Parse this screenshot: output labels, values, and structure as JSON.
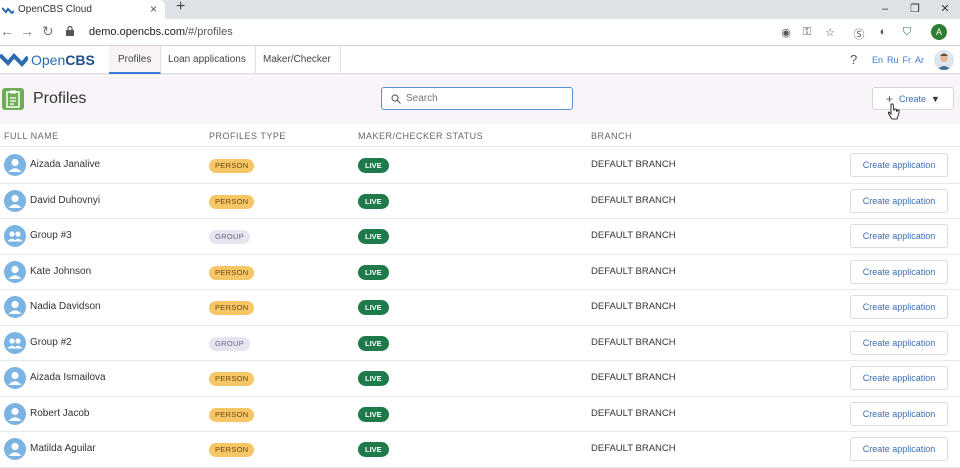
{
  "browser": {
    "tab_title": "OpenCBS Cloud",
    "url_host": "demo.opencbs.com",
    "url_path": "/#/profiles",
    "profile_initial": "A"
  },
  "app": {
    "logo_light": "Open",
    "logo_bold": "CBS",
    "nav": [
      "Profiles",
      "Loan applications",
      "Maker/Checker"
    ],
    "help": "?",
    "languages": [
      "En",
      "Ru",
      "Fr",
      "Ar"
    ]
  },
  "page": {
    "title": "Profiles",
    "search_placeholder": "Search",
    "create_label": "Create"
  },
  "table": {
    "headers": [
      "FULL NAME",
      "PROFILES TYPE",
      "MAKER/CHECKER STATUS",
      "BRANCH"
    ],
    "action_label": "Create application",
    "rows": [
      {
        "name": "Aizada Janalive",
        "type": "PERSON",
        "status": "LIVE",
        "branch": "DEFAULT BRANCH"
      },
      {
        "name": "David Duhovnyi",
        "type": "PERSON",
        "status": "LIVE",
        "branch": "DEFAULT BRANCH"
      },
      {
        "name": "Group #3",
        "type": "GROUP",
        "status": "LIVE",
        "branch": "DEFAULT BRANCH"
      },
      {
        "name": "Kate Johnson",
        "type": "PERSON",
        "status": "LIVE",
        "branch": "DEFAULT BRANCH"
      },
      {
        "name": "Nadia Davidson",
        "type": "PERSON",
        "status": "LIVE",
        "branch": "DEFAULT BRANCH"
      },
      {
        "name": "Group #2",
        "type": "GROUP",
        "status": "LIVE",
        "branch": "DEFAULT BRANCH"
      },
      {
        "name": "Aizada Ismailova",
        "type": "PERSON",
        "status": "LIVE",
        "branch": "DEFAULT BRANCH"
      },
      {
        "name": "Robert Jacob",
        "type": "PERSON",
        "status": "LIVE",
        "branch": "DEFAULT BRANCH"
      },
      {
        "name": "Matilda Aguilar",
        "type": "PERSON",
        "status": "LIVE",
        "branch": "DEFAULT BRANCH"
      }
    ]
  },
  "colors": {
    "accent": "#3a7bd5",
    "person_badge": "#f6c667",
    "group_badge": "#e8e3f0",
    "live_badge": "#1e7a4b",
    "avatar": "#7bb3e3"
  }
}
